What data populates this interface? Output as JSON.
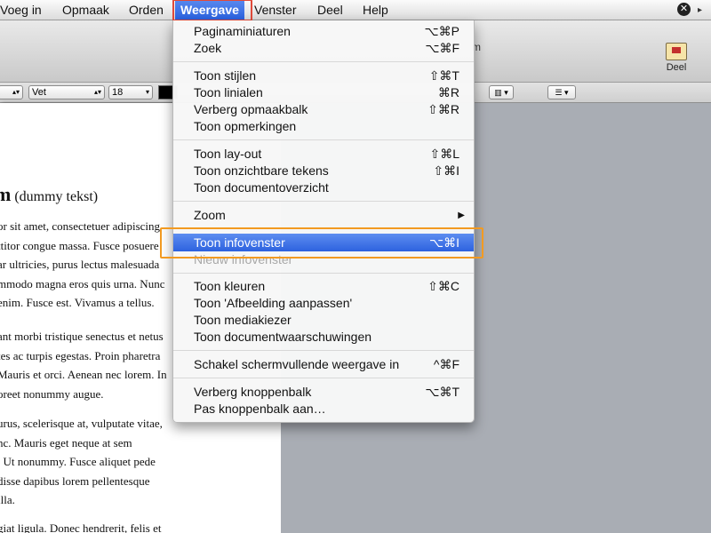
{
  "menubar": {
    "items": [
      "Voeg in",
      "Opmaak",
      "Orden",
      "Weergave",
      "Venster",
      "Deel",
      "Help"
    ],
    "active": "Weergave"
  },
  "window": {
    "title_fragment": "m",
    "share_label": "Deel"
  },
  "formatbar": {
    "style_value": "Vet",
    "size_value": "18"
  },
  "document": {
    "heading": "m",
    "heading_suffix": "(dummy tekst)",
    "paragraph1": [
      "or sit amet, consectetuer adipiscing",
      "ttitor congue massa. Fusce posuere",
      "ar ultricies, purus lectus malesuada",
      "mmodo magna eros quis urna. Nunc",
      "enim. Fusce est. Vivamus a tellus."
    ],
    "paragraph2": [
      "ant morbi tristique senectus et netus",
      "tes ac turpis egestas. Proin pharetra",
      "Mauris et orci. Aenean nec lorem. In",
      "oreet nonummy augue."
    ],
    "paragraph3": [
      "urus, scelerisque at, vulputate vitae,",
      "nc. Mauris eget neque at sem",
      ". Ut nonummy. Fusce aliquet pede",
      "disse dapibus lorem pellentesque",
      "illa."
    ],
    "paragraph4": [
      "giat ligula. Donec hendrerit, felis et"
    ]
  },
  "menu": {
    "groups": [
      [
        {
          "label": "Paginaminiaturen",
          "shortcut": "⌥⌘P"
        },
        {
          "label": "Zoek",
          "shortcut": "⌥⌘F"
        }
      ],
      [
        {
          "label": "Toon stijlen",
          "shortcut": "⇧⌘T"
        },
        {
          "label": "Toon linialen",
          "shortcut": "⌘R"
        },
        {
          "label": "Verberg opmaakbalk",
          "shortcut": "⇧⌘R"
        },
        {
          "label": "Toon opmerkingen",
          "shortcut": ""
        }
      ],
      [
        {
          "label": "Toon lay-out",
          "shortcut": "⇧⌘L"
        },
        {
          "label": "Toon onzichtbare tekens",
          "shortcut": "⇧⌘I"
        },
        {
          "label": "Toon documentoverzicht",
          "shortcut": ""
        }
      ],
      [
        {
          "label": "Zoom",
          "shortcut": "",
          "submenu": true
        }
      ],
      [
        {
          "label": "Toon infovenster",
          "shortcut": "⌥⌘I",
          "selected": true
        },
        {
          "label": "Nieuw infovenster",
          "shortcut": "",
          "disabled": true
        }
      ],
      [
        {
          "label": "Toon kleuren",
          "shortcut": "⇧⌘C"
        },
        {
          "label": "Toon 'Afbeelding aanpassen'",
          "shortcut": ""
        },
        {
          "label": "Toon mediakiezer",
          "shortcut": ""
        },
        {
          "label": "Toon documentwaarschuwingen",
          "shortcut": ""
        }
      ],
      [
        {
          "label": "Schakel schermvullende weergave in",
          "shortcut": "^⌘F"
        }
      ],
      [
        {
          "label": "Verberg knoppenbalk",
          "shortcut": "⌥⌘T"
        },
        {
          "label": "Pas knoppenbalk aan…",
          "shortcut": ""
        }
      ]
    ]
  },
  "colors": {
    "selection": "#3a6fe6",
    "annotation_red": "#e04a3a",
    "annotation_orange": "#f29a21"
  }
}
